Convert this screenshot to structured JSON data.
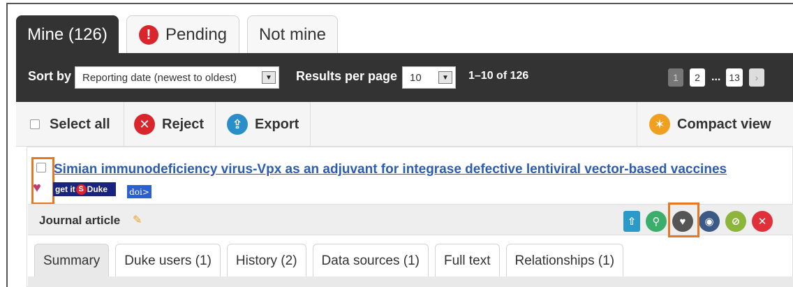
{
  "tabs": {
    "mine": "Mine (126)",
    "pending": "Pending",
    "not_mine": "Not mine"
  },
  "toolbar": {
    "sort_label": "Sort by",
    "sort_value": "Reporting date (newest to oldest)",
    "rpp_label": "Results per page",
    "rpp_value": "10",
    "range": "1–10 of 126",
    "pages": [
      "1",
      "2",
      "...",
      "13"
    ]
  },
  "actions": {
    "select_all": "Select all",
    "reject": "Reject",
    "export": "Export",
    "compact_view": "Compact view"
  },
  "record": {
    "title": "Simian immunodeficiency virus-Vpx as an adjuvant for integrase defective lentiviral vector-based vaccines",
    "getit_prefix": "get it",
    "getit_brand": "Duke",
    "doi": "doi>",
    "type": "Journal article",
    "subtabs": [
      "Summary",
      "Duke users (1)",
      "History (2)",
      "Data sources (1)",
      "Full text",
      "Relationships (1)"
    ]
  },
  "colors": {
    "toolbar_bg": "#333333",
    "reject": "#d9262c",
    "export": "#2a8fc8",
    "compact": "#f0a020",
    "highlight": "#e87722",
    "link": "#2a5db0"
  }
}
